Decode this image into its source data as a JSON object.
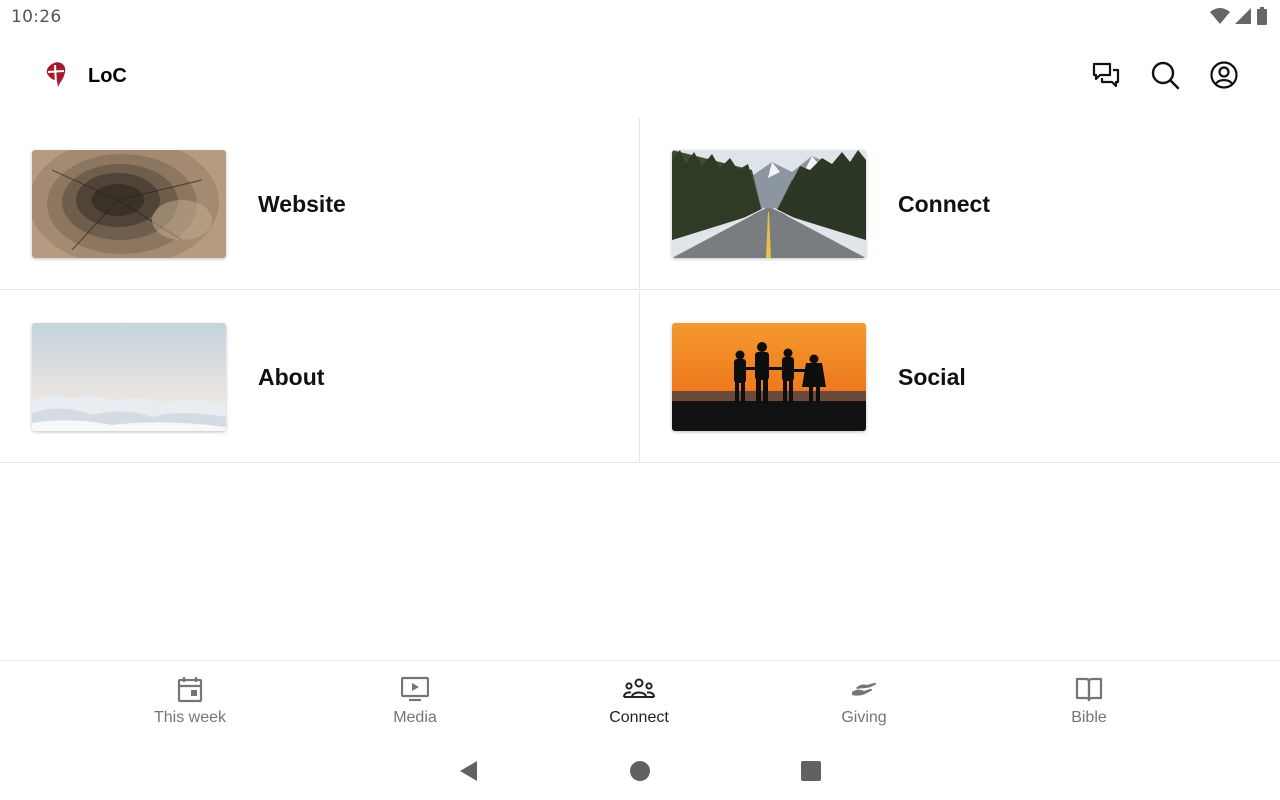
{
  "status_bar": {
    "time": "10:26"
  },
  "app_bar": {
    "title": "LoC"
  },
  "tiles": [
    {
      "label": "Website"
    },
    {
      "label": "Connect"
    },
    {
      "label": "About"
    },
    {
      "label": "Social"
    }
  ],
  "bottom_nav": {
    "active": "Connect",
    "items": [
      {
        "label": "This week",
        "icon": "calendar-icon"
      },
      {
        "label": "Media",
        "icon": "video-play-icon"
      },
      {
        "label": "Connect",
        "icon": "people-group-icon"
      },
      {
        "label": "Giving",
        "icon": "giving-hand-icon"
      },
      {
        "label": "Bible",
        "icon": "open-book-icon"
      }
    ]
  },
  "colors": {
    "brand": "#a6192e",
    "active_nav": "#222222",
    "inactive_nav": "#757575"
  }
}
